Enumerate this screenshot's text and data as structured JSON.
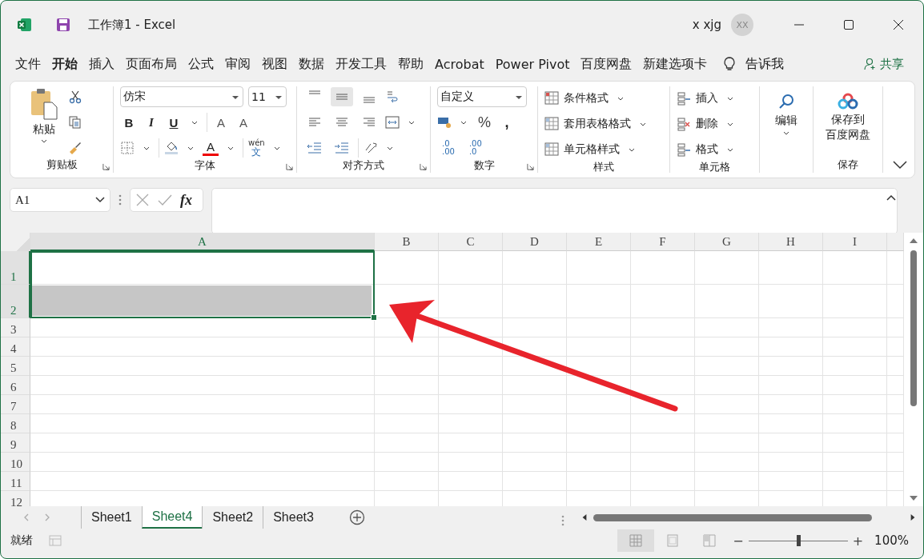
{
  "window": {
    "title": "工作簿1  -  Excel",
    "user": "x xjg",
    "avatar": "XX"
  },
  "menu_tabs": [
    {
      "label": "文件",
      "selected": false
    },
    {
      "label": "开始",
      "selected": true
    },
    {
      "label": "插入",
      "selected": false
    },
    {
      "label": "页面布局",
      "selected": false
    },
    {
      "label": "公式",
      "selected": false
    },
    {
      "label": "审阅",
      "selected": false
    },
    {
      "label": "视图",
      "selected": false
    },
    {
      "label": "数据",
      "selected": false
    },
    {
      "label": "开发工具",
      "selected": false
    },
    {
      "label": "帮助",
      "selected": false
    },
    {
      "label": "Acrobat",
      "selected": false
    },
    {
      "label": "Power Pivot",
      "selected": false
    },
    {
      "label": "百度网盘",
      "selected": false
    },
    {
      "label": "新建选项卡",
      "selected": false
    }
  ],
  "tell_me": "告诉我",
  "share": "共享",
  "ribbon": {
    "clipboard": {
      "paste": "粘贴",
      "label": "剪贴板"
    },
    "font": {
      "name": "仿宋",
      "size": "11",
      "bold": "B",
      "italic": "I",
      "underline": "U",
      "grow": "A",
      "shrink": "A",
      "font_color": "A",
      "phonetic_top": "wén",
      "phonetic_char": "文",
      "label": "字体"
    },
    "alignment": {
      "label": "对齐方式",
      "vertical": [
        {
          "selected": false
        },
        {
          "selected": true
        },
        {
          "selected": false
        }
      ]
    },
    "number": {
      "format": "自定义",
      "percent": "%",
      "comma": ",",
      "increase_decimal": [
        ".0",
        ".00"
      ],
      "decrease_decimal": [
        ".00",
        ".0"
      ],
      "label": "数字"
    },
    "styles": {
      "items": [
        "条件格式",
        "套用表格格式",
        "单元格样式"
      ],
      "label": "样式"
    },
    "cells": {
      "items": [
        "插入",
        "删除",
        "格式"
      ],
      "label": "单元格"
    },
    "editing": {
      "label": "编辑"
    },
    "save": {
      "lines": [
        "保存到",
        "百度网盘"
      ],
      "label": "保存"
    }
  },
  "formula_bar": {
    "name_box": "A1",
    "fx": "fx"
  },
  "grid": {
    "columns": [
      {
        "label": "A",
        "selected": true
      },
      {
        "label": "B",
        "selected": false
      },
      {
        "label": "C",
        "selected": false
      },
      {
        "label": "D",
        "selected": false
      },
      {
        "label": "E",
        "selected": false
      },
      {
        "label": "F",
        "selected": false
      },
      {
        "label": "G",
        "selected": false
      },
      {
        "label": "H",
        "selected": false
      },
      {
        "label": "I",
        "selected": false
      }
    ],
    "rows": [
      {
        "label": "1",
        "selected": true,
        "tall": true,
        "shaded": false
      },
      {
        "label": "2",
        "selected": true,
        "tall": true,
        "shaded": true
      },
      {
        "label": "3",
        "selected": false,
        "tall": false,
        "shaded": false
      },
      {
        "label": "4",
        "selected": false,
        "tall": false,
        "shaded": false
      },
      {
        "label": "5",
        "selected": false,
        "tall": false,
        "shaded": false
      },
      {
        "label": "6",
        "selected": false,
        "tall": false,
        "shaded": false
      },
      {
        "label": "7",
        "selected": false,
        "tall": false,
        "shaded": false
      },
      {
        "label": "8",
        "selected": false,
        "tall": false,
        "shaded": false
      },
      {
        "label": "9",
        "selected": false,
        "tall": false,
        "shaded": false
      },
      {
        "label": "10",
        "selected": false,
        "tall": false,
        "shaded": false
      },
      {
        "label": "11",
        "selected": false,
        "tall": false,
        "shaded": false
      },
      {
        "label": "12",
        "selected": false,
        "tall": false,
        "shaded": false
      }
    ]
  },
  "sheets": [
    {
      "label": "Sheet1",
      "selected": false
    },
    {
      "label": "Sheet4",
      "selected": true
    },
    {
      "label": "Sheet2",
      "selected": false
    },
    {
      "label": "Sheet3",
      "selected": false
    }
  ],
  "status_bar": {
    "status": "就绪",
    "views": [
      {
        "kind": "normal",
        "selected": true
      },
      {
        "kind": "page_layout",
        "selected": false
      },
      {
        "kind": "page_break",
        "selected": false
      }
    ],
    "zoom_out": "−",
    "zoom": {
      "level": 0.5
    },
    "zoom_in": "+",
    "zoom_label": "100%"
  }
}
